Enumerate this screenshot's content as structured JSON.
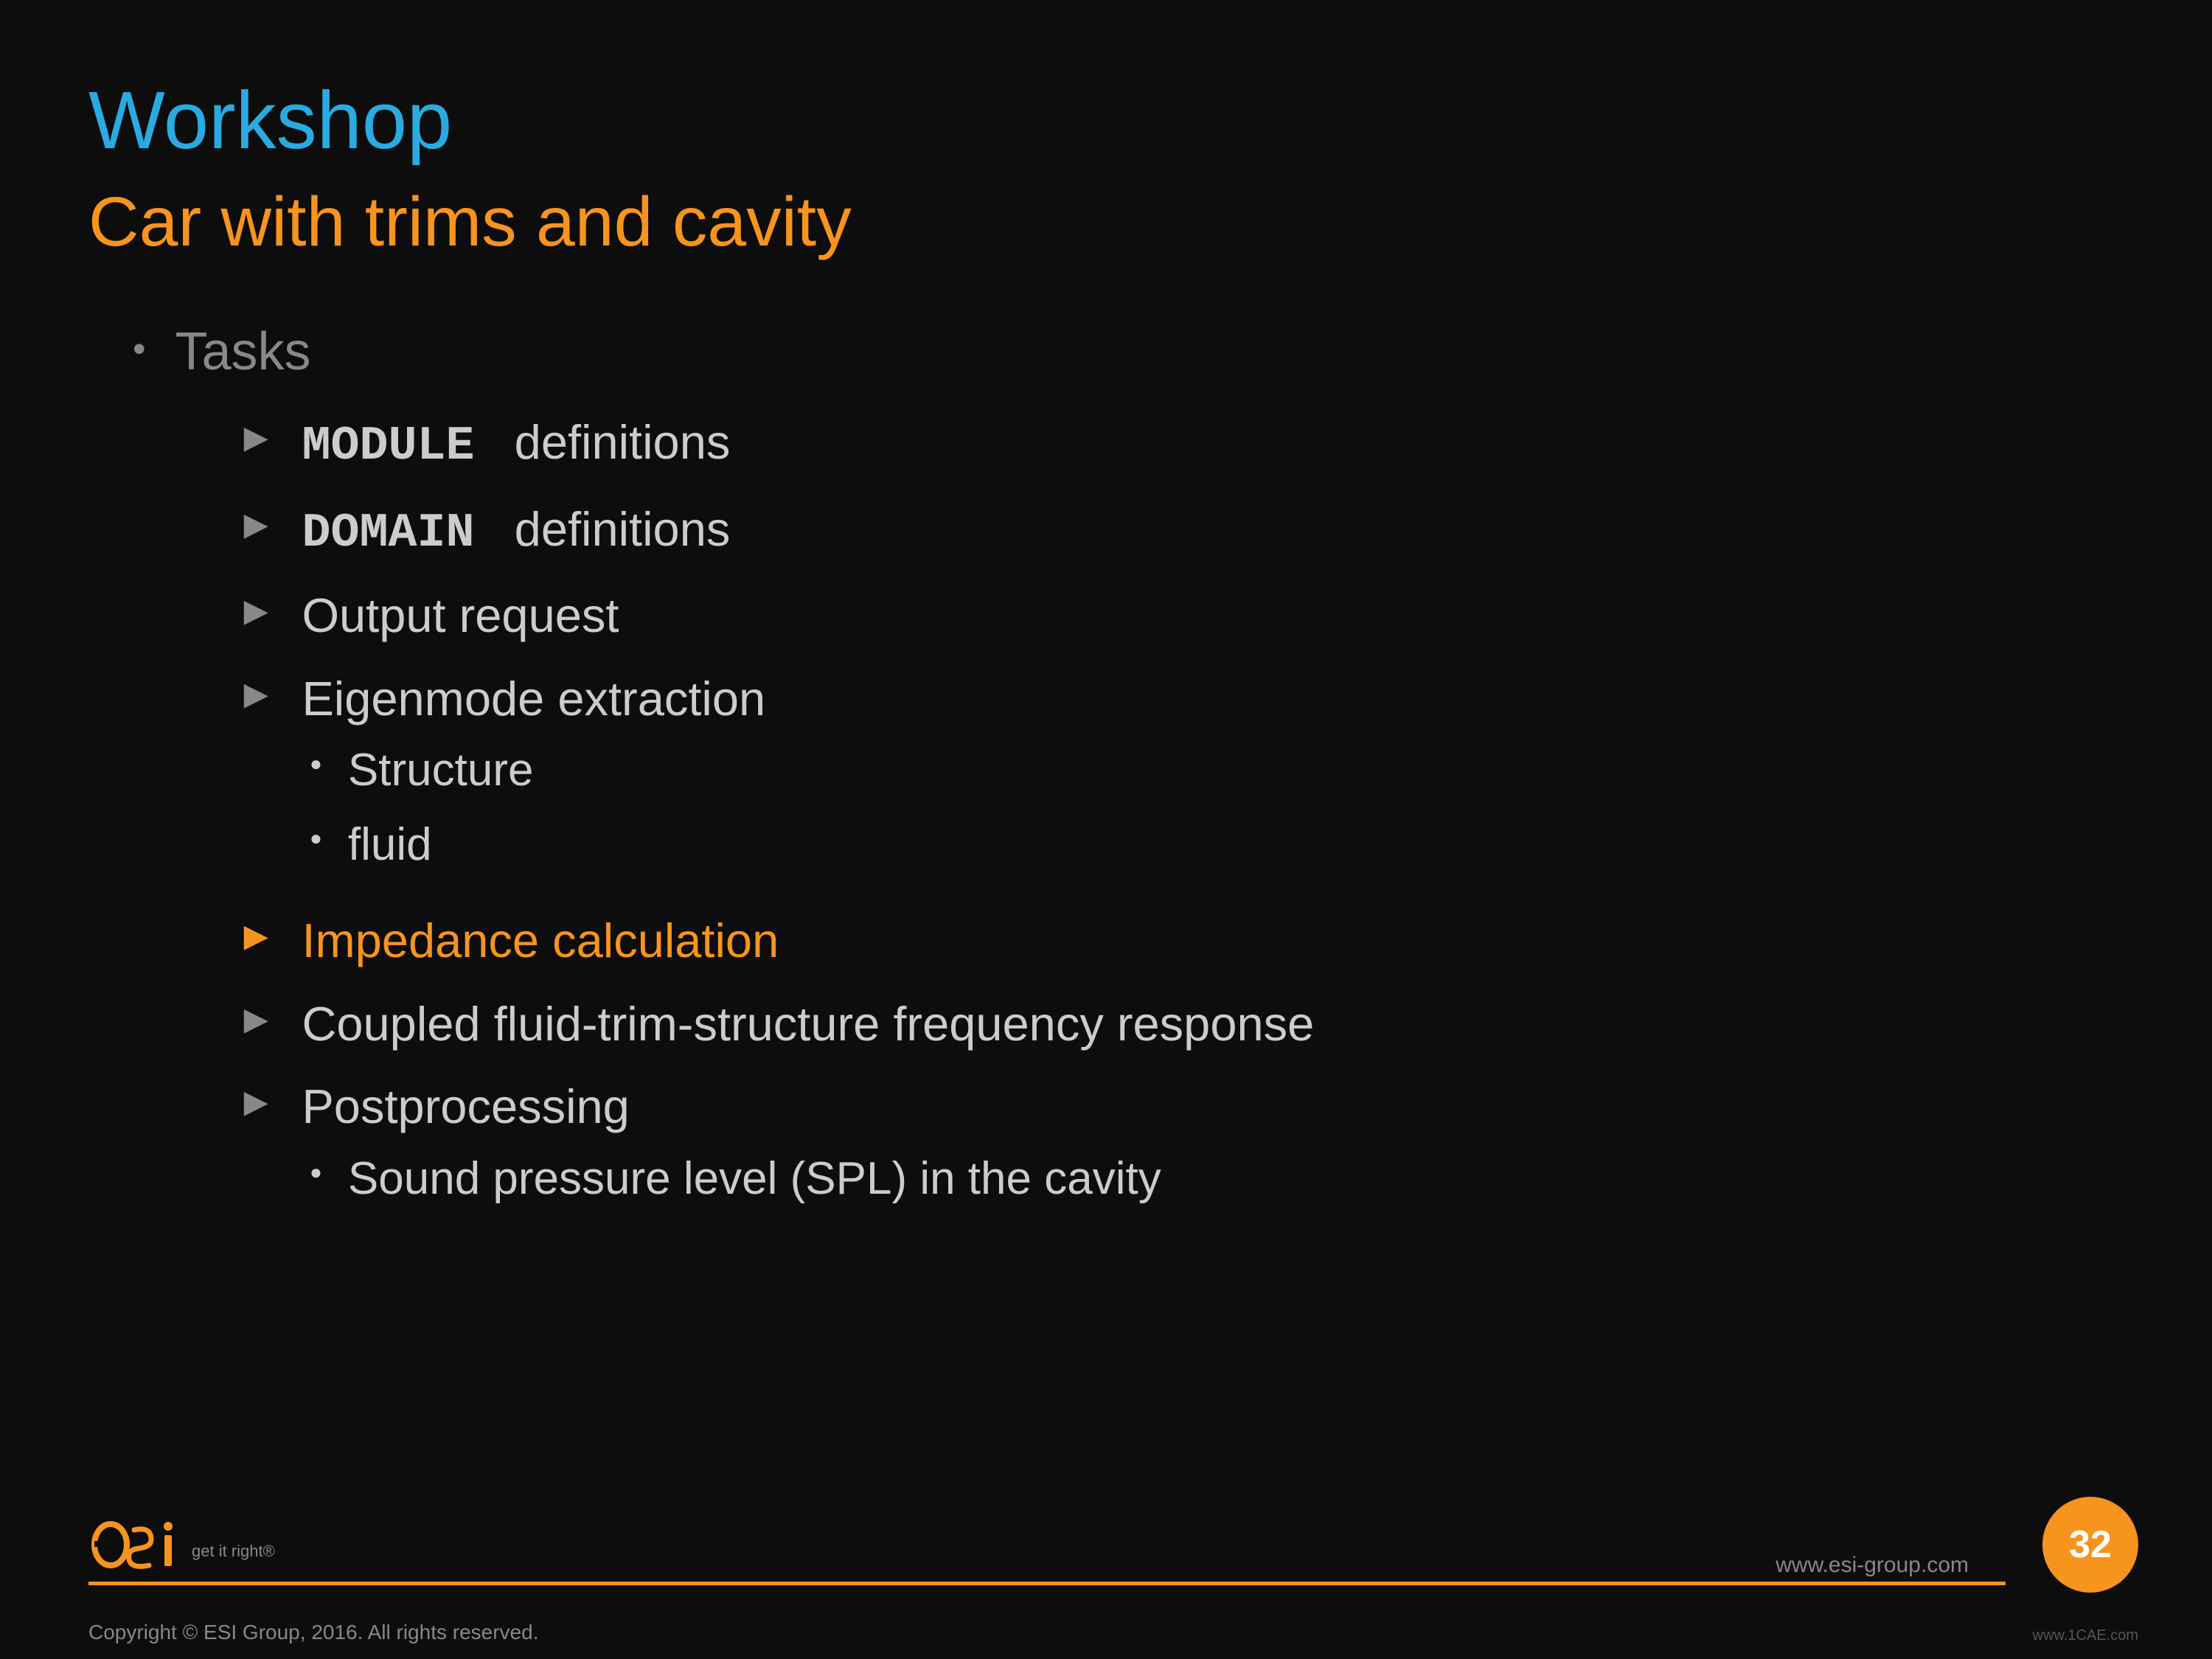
{
  "slide": {
    "title": "Workshop",
    "subtitle": "Car with trims and cavity",
    "background_color": "#0d0d0d"
  },
  "content": {
    "top_bullet": "Tasks",
    "items": [
      {
        "arrow_color": "gray",
        "bold_part": "MODULE",
        "normal_part": "  definitions",
        "has_bold": true
      },
      {
        "arrow_color": "gray",
        "bold_part": "DOMAIN",
        "normal_part": "  definitions",
        "has_bold": true
      },
      {
        "arrow_color": "gray",
        "text": "Output request",
        "has_bold": false
      },
      {
        "arrow_color": "gray",
        "text": "Eigenmode extraction",
        "has_bold": false,
        "sub_items": [
          "Structure",
          "fluid"
        ]
      },
      {
        "arrow_color": "orange",
        "text": "Impedance calculation",
        "has_bold": false,
        "is_orange": true
      },
      {
        "arrow_color": "gray",
        "text": "Coupled fluid-trim-structure frequency response",
        "has_bold": false
      },
      {
        "arrow_color": "gray",
        "text": "Postprocessing",
        "has_bold": false,
        "sub_items": [
          "Sound pressure level (SPL) in the cavity"
        ]
      }
    ]
  },
  "footer": {
    "copyright": "Copyright © ESI Group, 2016. All rights reserved.",
    "website": "www.esi-group.com",
    "page_number": "32",
    "get_it_right": "get it right®",
    "watermark": "www.1CAE.com"
  }
}
